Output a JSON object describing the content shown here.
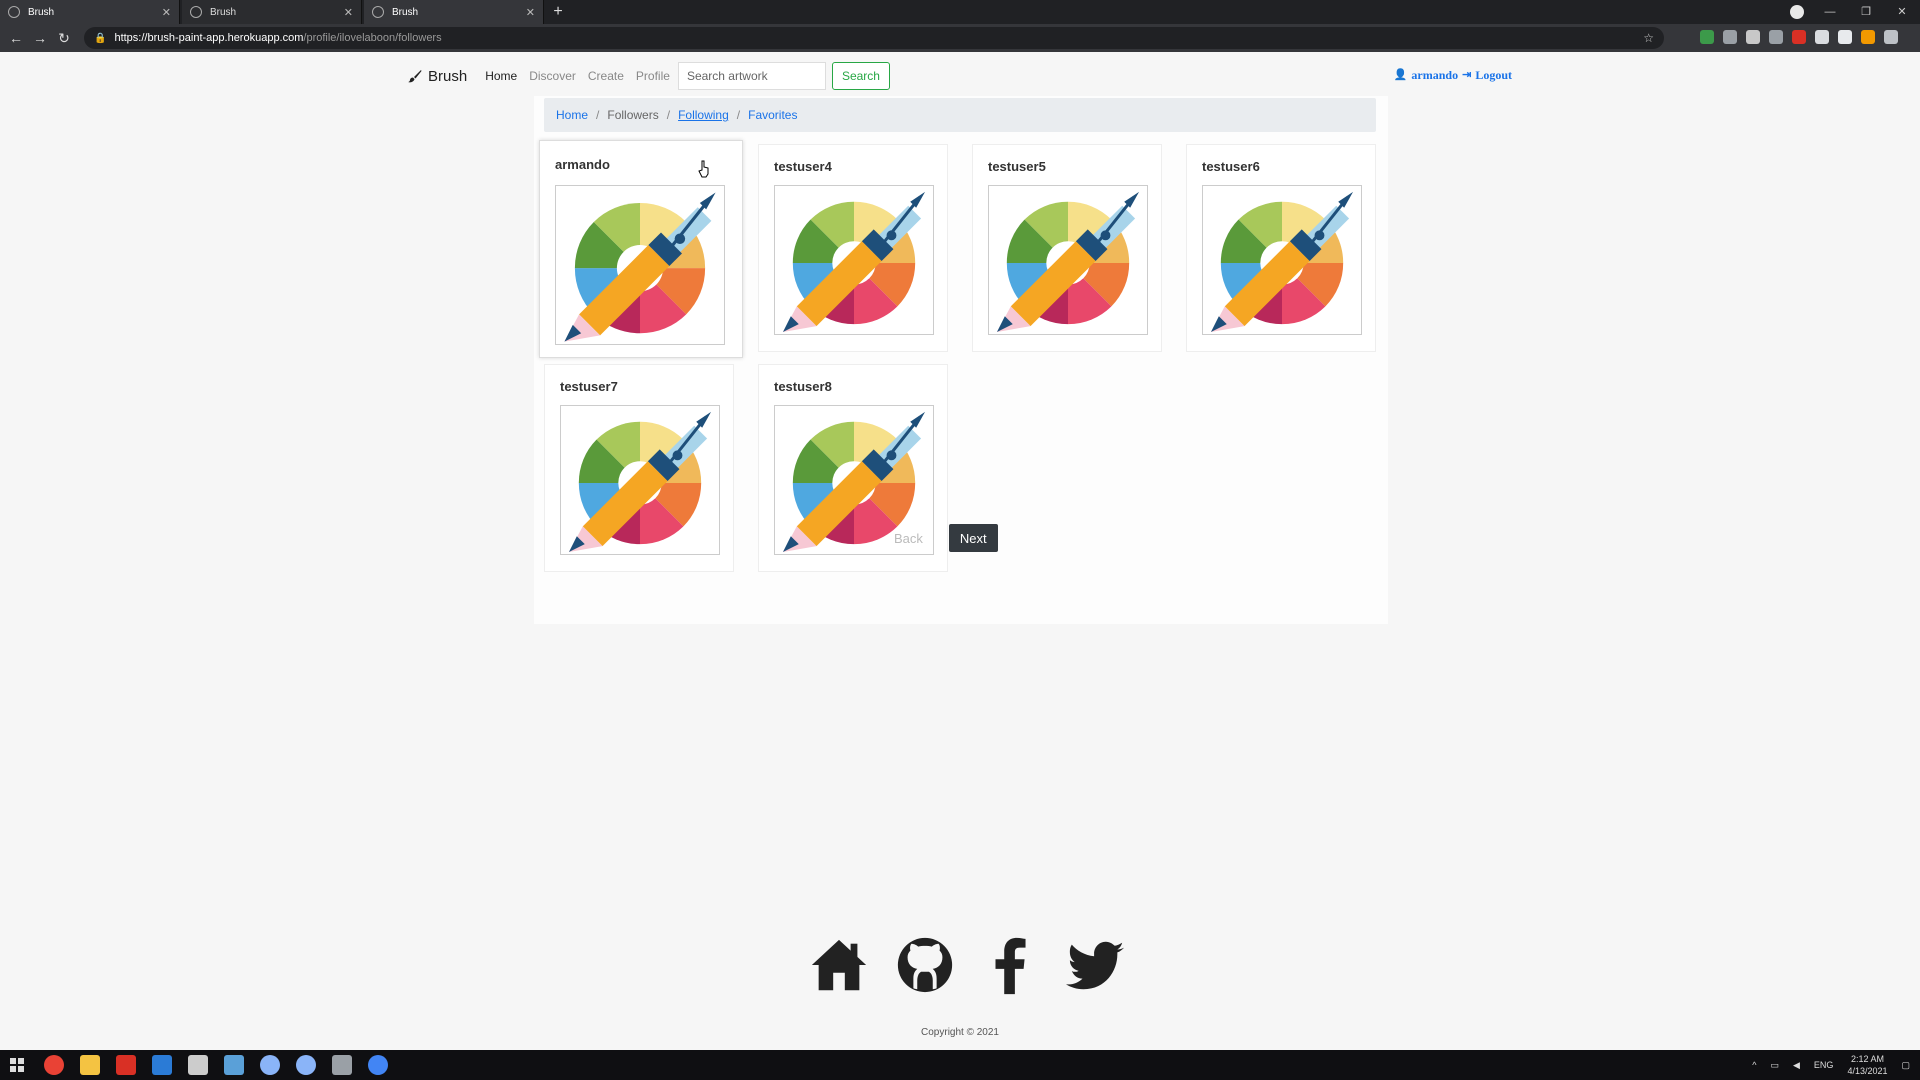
{
  "browser": {
    "tabs": [
      {
        "title": "Brush"
      },
      {
        "title": "Brush"
      },
      {
        "title": "Brush"
      }
    ],
    "url_host": "https://brush-paint-app.herokuapp.com",
    "url_path": "/profile/ilovelaboon/followers"
  },
  "navbar": {
    "brand": "Brush",
    "links": [
      "Home",
      "Discover",
      "Create",
      "Profile"
    ],
    "search_placeholder": "Search artwork",
    "search_button": "Search",
    "username": "armando",
    "logout": "Logout"
  },
  "breadcrumb": {
    "home": "Home",
    "followers": "Followers",
    "following": "Following",
    "favorites": "Favorites",
    "separator": "/"
  },
  "users": [
    {
      "name": "armando"
    },
    {
      "name": "testuser4"
    },
    {
      "name": "testuser5"
    },
    {
      "name": "testuser6"
    },
    {
      "name": "testuser7"
    },
    {
      "name": "testuser8"
    }
  ],
  "pager": {
    "back": "Back",
    "next": "Next"
  },
  "footer": {
    "icons": [
      "home-icon",
      "github-icon",
      "facebook-icon",
      "twitter-icon"
    ],
    "copyright": "Copyright © 2021"
  },
  "taskbar": {
    "language": "ENG",
    "time": "2:12 AM",
    "date": "4/13/2021"
  },
  "colors": {
    "accent_link": "#1a73e8",
    "search_green": "#28a745",
    "next_dark": "#343a40"
  }
}
